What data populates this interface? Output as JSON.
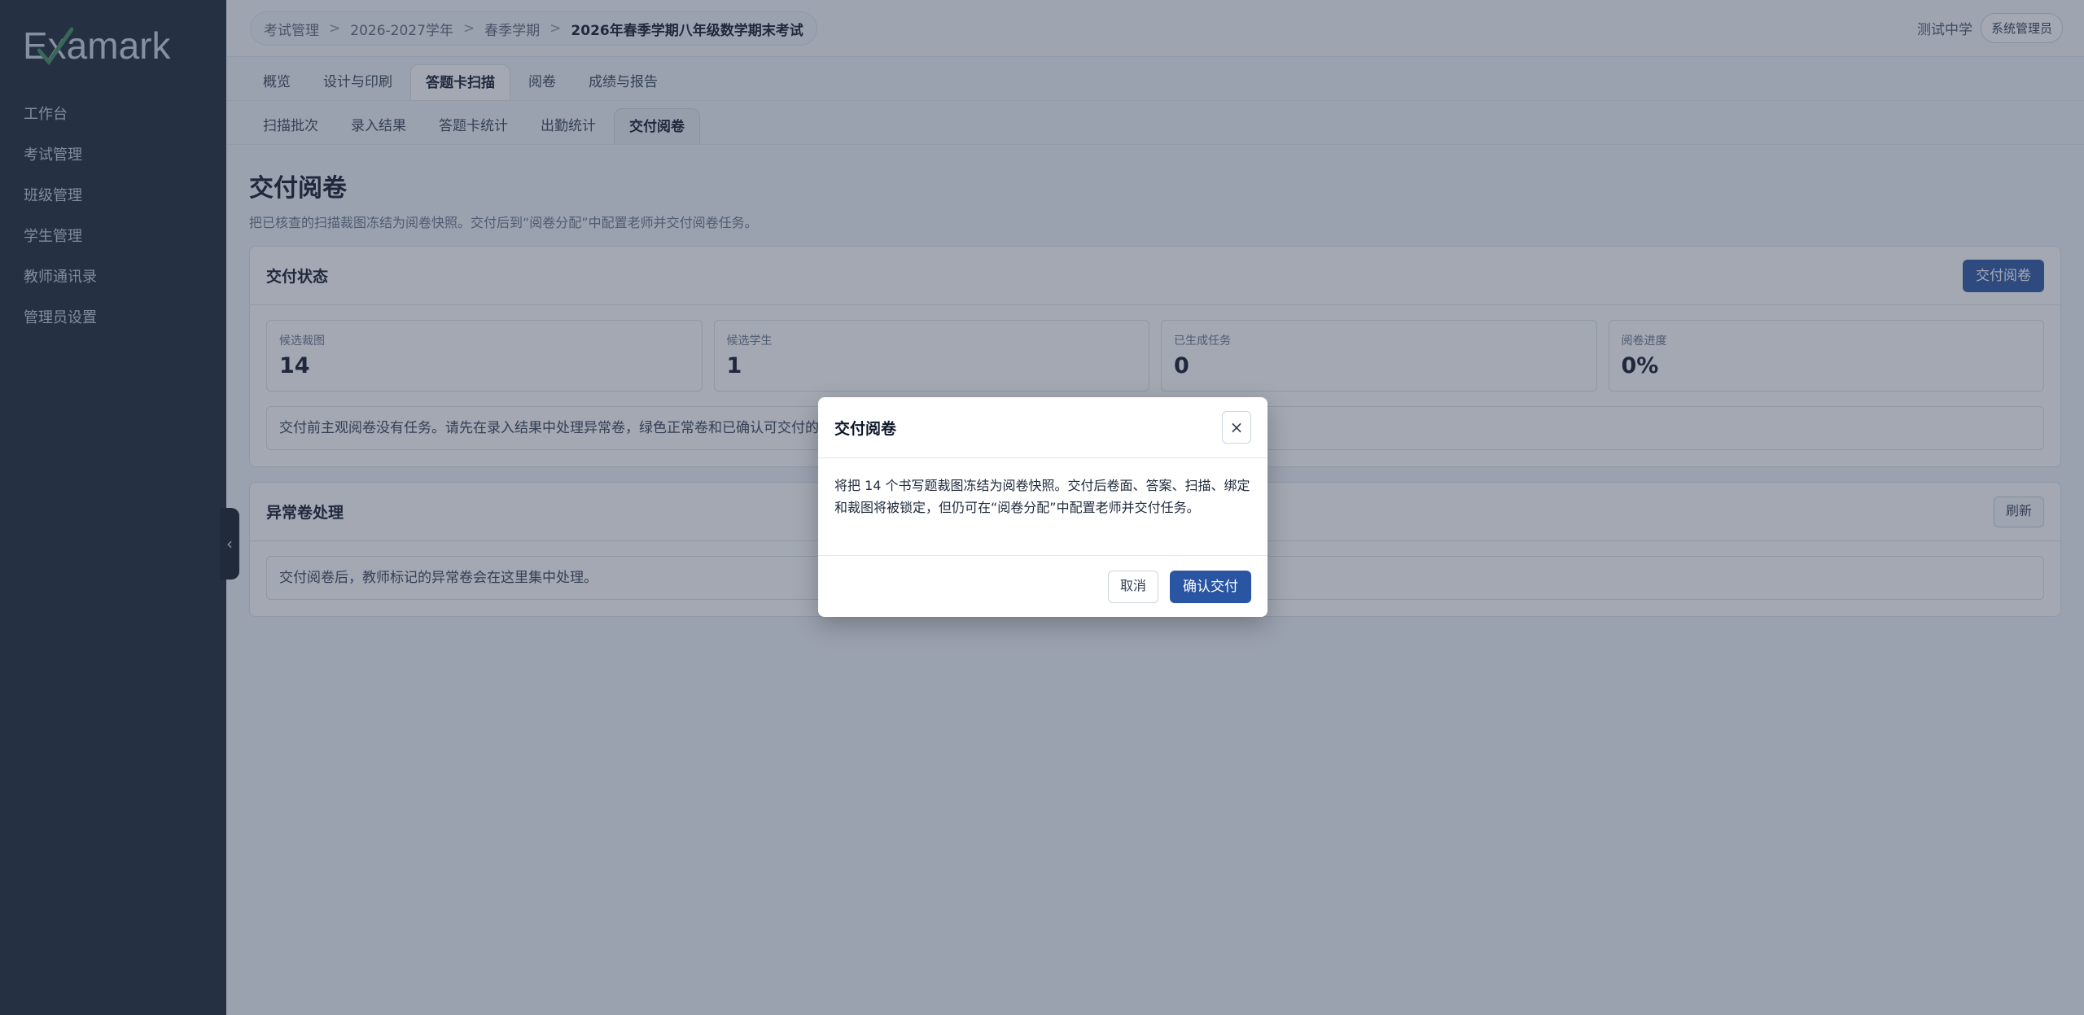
{
  "brand": {
    "logo_text": "Examark"
  },
  "sidebar": {
    "items": [
      {
        "label": "工作台"
      },
      {
        "label": "考试管理"
      },
      {
        "label": "班级管理"
      },
      {
        "label": "学生管理"
      },
      {
        "label": "教师通讯录"
      },
      {
        "label": "管理员设置"
      }
    ],
    "collapse_glyph": "‹"
  },
  "breadcrumb": {
    "items": [
      "考试管理",
      "2026-2027学年",
      "春季学期",
      "2026年春季学期八年级数学期末考试"
    ],
    "separator": ">"
  },
  "user": {
    "school": "测试中学",
    "role": "系统管理员"
  },
  "tabs": {
    "primary": [
      "概览",
      "设计与印刷",
      "答题卡扫描",
      "阅卷",
      "成绩与报告"
    ],
    "secondary": [
      "扫描批次",
      "录入结果",
      "答题卡统计",
      "出勤统计",
      "交付阅卷"
    ]
  },
  "page": {
    "title": "交付阅卷",
    "subtitle": "把已核查的扫描裁图冻结为阅卷快照。交付后到“阅卷分配”中配置老师并交付阅卷任务。"
  },
  "status_card": {
    "title": "交付状态",
    "action_label": "交付阅卷",
    "stats": [
      {
        "label": "候选裁图",
        "value": "14"
      },
      {
        "label": "候选学生",
        "value": "1"
      },
      {
        "label": "已生成任务",
        "value": "0"
      },
      {
        "label": "阅卷进度",
        "value": "0%"
      }
    ],
    "notice": "交付前主观阅卷没有任务。请先在录入结果中处理异常卷，绿色正常卷和已确认可交付的异常卷"
  },
  "exception_card": {
    "title": "异常卷处理",
    "refresh_label": "刷新",
    "notice": "交付阅卷后，教师标记的异常卷会在这里集中处理。"
  },
  "modal": {
    "title": "交付阅卷",
    "close_glyph": "×",
    "body": "将把 14 个书写题裁图冻结为阅卷快照。交付后卷面、答案、扫描、绑定和裁图将被锁定，但仍可在“阅卷分配”中配置老师并交付任务。",
    "cancel_label": "取消",
    "confirm_label": "确认交付"
  },
  "colors": {
    "sidebar_bg": "#1a2535",
    "primary": "#2a55a3",
    "overlay": "#333e54"
  }
}
